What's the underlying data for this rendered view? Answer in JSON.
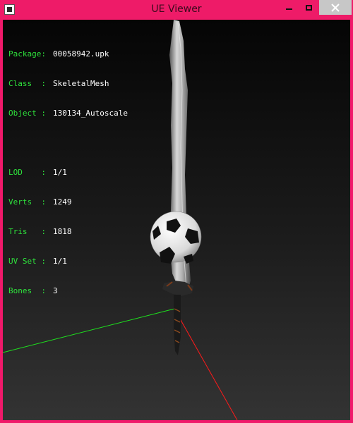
{
  "window": {
    "title": "UE Viewer"
  },
  "colors": {
    "frame": "#f0196a",
    "label": "#2ee23c",
    "value": "#ffffff",
    "x_axis": "#ff1a1a",
    "y_axis": "#1ee01e"
  },
  "info": {
    "package": {
      "label": "Package:",
      "value": "00058942.upk"
    },
    "class": {
      "label": "Class  :",
      "value": "SkeletalMesh"
    },
    "object": {
      "label": "Object :",
      "value": "130134_Autoscale"
    },
    "lod": {
      "label": "LOD    :",
      "value": "1/1"
    },
    "verts": {
      "label": "Verts  :",
      "value": "1249"
    },
    "tris": {
      "label": "Tris   :",
      "value": "1818"
    },
    "uvset": {
      "label": "UV Set :",
      "value": "1/1"
    },
    "bones": {
      "label": "Bones  :",
      "value": "3"
    }
  }
}
